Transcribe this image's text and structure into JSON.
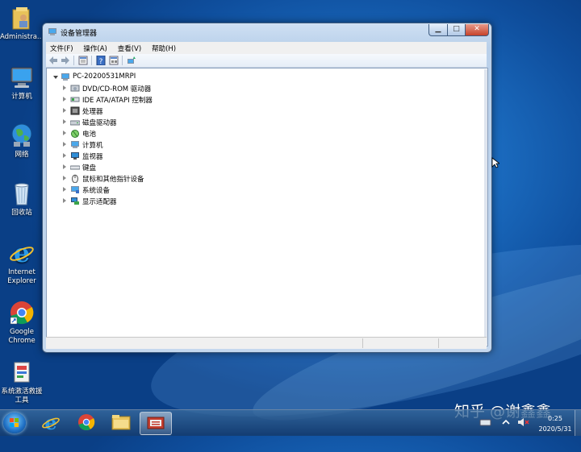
{
  "desktop": {
    "icons": [
      {
        "label": "Administra...",
        "icon": "user-folder-icon"
      },
      {
        "label": "计算机",
        "icon": "computer-icon"
      },
      {
        "label": "网络",
        "icon": "network-globe-icon"
      },
      {
        "label": "回收站",
        "icon": "recycle-bin-icon"
      },
      {
        "label": "Internet Explorer",
        "icon": "ie-icon"
      },
      {
        "label": "Google Chrome",
        "icon": "chrome-icon"
      },
      {
        "label": "系统激活救援工具",
        "icon": "tool-shortcut-icon"
      }
    ]
  },
  "window": {
    "title": "设备管理器",
    "buttons": {
      "minimize": "▁",
      "maximize": "□",
      "close": "✕"
    },
    "menu": [
      "文件(F)",
      "操作(A)",
      "查看(V)",
      "帮助(H)"
    ],
    "toolbar": [
      "back-icon",
      "forward-icon",
      "properties-icon",
      "help-icon",
      "view-icon",
      "scan-hardware-icon"
    ],
    "tree": {
      "root": "PC-20200531MRPI",
      "items": [
        {
          "label": "DVD/CD-ROM 驱动器",
          "icon": "dvd-drive-icon"
        },
        {
          "label": "IDE ATA/ATAPI 控制器",
          "icon": "ide-controller-icon"
        },
        {
          "label": "处理器",
          "icon": "processor-icon"
        },
        {
          "label": "磁盘驱动器",
          "icon": "disk-drive-icon"
        },
        {
          "label": "电池",
          "icon": "battery-icon"
        },
        {
          "label": "计算机",
          "icon": "computer-icon"
        },
        {
          "label": "监视器",
          "icon": "monitor-icon"
        },
        {
          "label": "键盘",
          "icon": "keyboard-icon"
        },
        {
          "label": "鼠标和其他指针设备",
          "icon": "mouse-icon"
        },
        {
          "label": "系统设备",
          "icon": "system-devices-icon"
        },
        {
          "label": "显示适配器",
          "icon": "display-adapter-icon"
        }
      ]
    }
  },
  "taskbar": {
    "pinned": [
      "ie-icon",
      "chrome-icon",
      "explorer-folder-icon",
      "device-manager-icon"
    ],
    "clock": {
      "time": "0:25",
      "date": "2020/5/31"
    }
  },
  "watermark": "知乎 @谢鑫鑫",
  "colors": {
    "accent": "#1b6cc0",
    "close": "#c6432b"
  }
}
